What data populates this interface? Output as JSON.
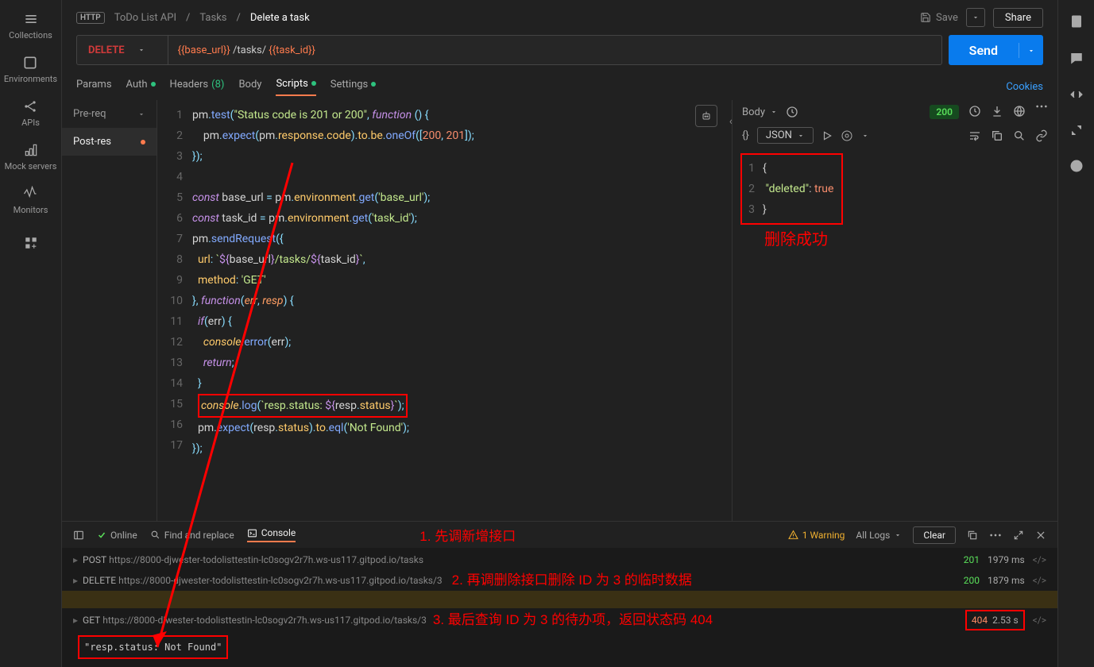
{
  "sidebar": {
    "items": [
      {
        "label": "Collections"
      },
      {
        "label": "Environments"
      },
      {
        "label": "APIs"
      },
      {
        "label": "Mock servers"
      },
      {
        "label": "Monitors"
      }
    ]
  },
  "breadcrumb": {
    "badge": "HTTP",
    "path1": "ToDo List API",
    "path2": "Tasks",
    "current": "Delete a task"
  },
  "topbar": {
    "save": "Save",
    "share": "Share"
  },
  "request": {
    "method": "DELETE",
    "url_part1": "{{base_url}}",
    "url_part2": " /tasks/ ",
    "url_part3": "{{task_id}}",
    "send": "Send"
  },
  "tabs": {
    "params": "Params",
    "auth": "Auth",
    "headers": "Headers",
    "headers_count": "(8)",
    "body": "Body",
    "scripts": "Scripts",
    "settings": "Settings",
    "cookies": "Cookies"
  },
  "script_tabs": {
    "pre": "Pre-req",
    "post": "Post-res"
  },
  "code_lines": [
    "1",
    "2",
    "3",
    "4",
    "5",
    "6",
    "7",
    "8",
    "9",
    "10",
    "11",
    "12",
    "13",
    "14",
    "15",
    "16",
    "17"
  ],
  "response": {
    "body_label": "Body",
    "status": "200",
    "json_label": "JSON",
    "json_lines": [
      "1",
      "2",
      "3"
    ],
    "json_l1": "{",
    "json_key": "\"deleted\"",
    "json_colon": ": ",
    "json_val": "true",
    "json_l3": "}",
    "annotation": "删除成功"
  },
  "statusbar": {
    "online": "Online",
    "find": "Find and replace",
    "console": "Console",
    "warning": "1 Warning",
    "all_logs": "All Logs",
    "clear": "Clear"
  },
  "annotations": {
    "a1": "1. 先调新增接口",
    "a2": "2. 再调删除接口删除 ID 为 3 的临时数据",
    "a3": "3. 最后查询 ID 为 3 的待办项，返回状态码 404"
  },
  "console": {
    "l1_method": "POST",
    "l1_url": "https://8000-djwester-todolisttestin-lc0sogv2r7h.ws-us117.gitpod.io/tasks",
    "l1_status": "201",
    "l1_time": "1979 ms",
    "l2_method": "DELETE",
    "l2_url": "https://8000-djwester-todolisttestin-lc0sogv2r7h.ws-us117.gitpod.io/tasks/3",
    "l2_status": "200",
    "l2_time": "1879 ms",
    "l3_method": "GET",
    "l3_url": "https://8000-djwester-todolisttestin-lc0sogv2r7h.ws-us117.gitpod.io/tasks/3",
    "l3_status": "404",
    "l3_time": "2.53 s",
    "result": "\"resp.status: Not Found\""
  }
}
